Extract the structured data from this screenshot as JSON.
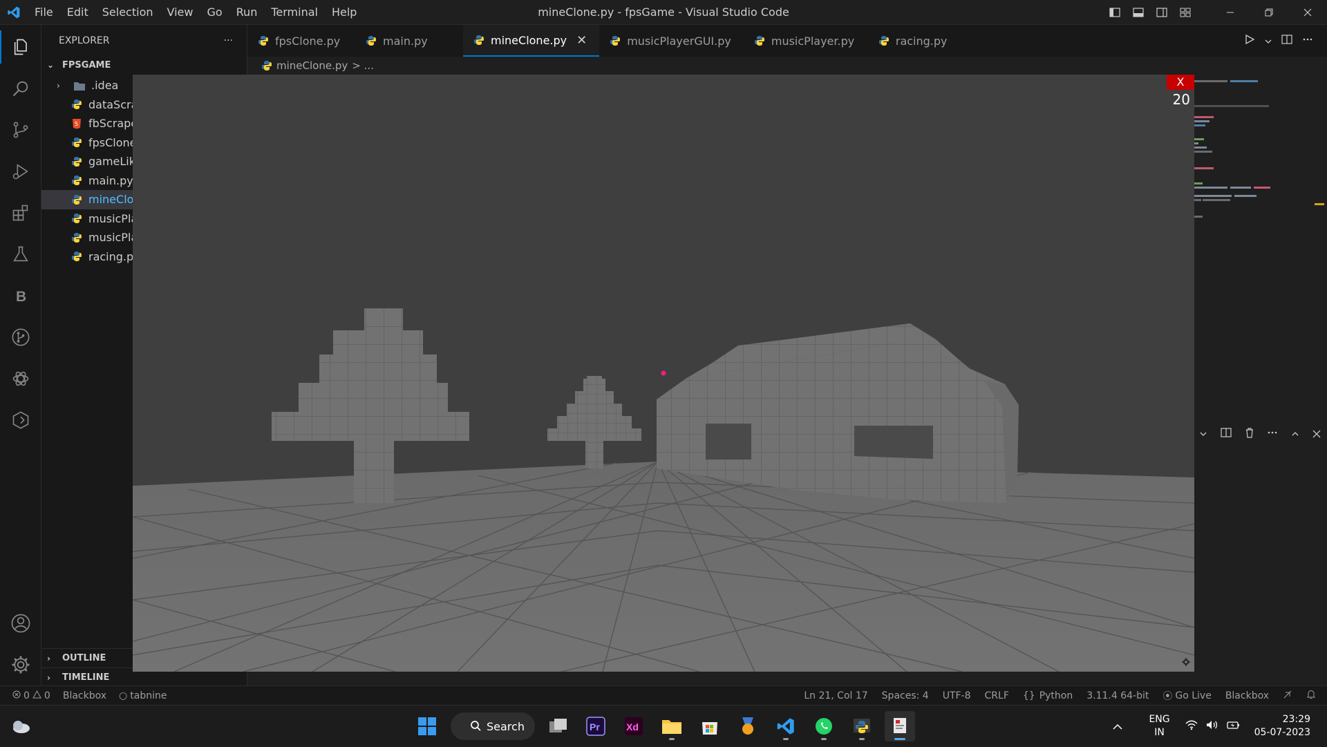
{
  "window": {
    "title": "mineClone.py - fpsGame - Visual Studio Code"
  },
  "menu": [
    "File",
    "Edit",
    "Selection",
    "View",
    "Go",
    "Run",
    "Terminal",
    "Help"
  ],
  "sidebar": {
    "header": "EXPLORER",
    "more": "···",
    "folder": "FPSGAME",
    "items": [
      {
        "label": ".idea",
        "type": "folder"
      },
      {
        "label": "dataScraper.py",
        "type": "python"
      },
      {
        "label": "fbScraper.html",
        "type": "html"
      },
      {
        "label": "fpsClone.py",
        "type": "python"
      },
      {
        "label": "gameLike.py",
        "type": "python"
      },
      {
        "label": "main.py",
        "type": "python"
      },
      {
        "label": "mineClone.py",
        "type": "python",
        "active": true
      },
      {
        "label": "musicPlayerGUI.py",
        "type": "python"
      },
      {
        "label": "musicPlayer.py",
        "type": "python"
      },
      {
        "label": "racing.py",
        "type": "python"
      }
    ],
    "outline": "OUTLINE",
    "timeline": "TIMELINE"
  },
  "tabs": [
    {
      "label": "fpsClone.py"
    },
    {
      "label": "main.py"
    },
    {
      "label": "mineClone.py",
      "active": true
    },
    {
      "label": "musicPlayerGUI.py"
    },
    {
      "label": "musicPlayer.py"
    },
    {
      "label": "racing.py"
    }
  ],
  "breadcrumb": {
    "file": "mineClone.py",
    "rest": "> ..."
  },
  "game": {
    "close": "X",
    "fps": "20",
    "floor_color": "#6e6e6e",
    "sky_color": "#3f3f3f",
    "block_color": "#727272",
    "crosshair_color": "#ff1c7c"
  },
  "status": {
    "errors": "0",
    "warnings": "0",
    "blackbox": "Blackbox",
    "tabnine": "tabnine",
    "cursor": "Ln 21, Col 17",
    "spaces": "Spaces: 4",
    "encoding": "UTF-8",
    "eol": "CRLF",
    "language": "Python",
    "interpreter": "3.11.4 64-bit",
    "golive": "Go Live",
    "blackbox_right": "Blackbox"
  },
  "taskbar": {
    "search": "Search",
    "lang1": "ENG",
    "lang2": "IN",
    "time": "23:29",
    "date": "05-07-2023"
  },
  "colors": {
    "accent": "#0078d4",
    "python_blue": "#3572a5",
    "python_yellow": "#ffd43b"
  }
}
